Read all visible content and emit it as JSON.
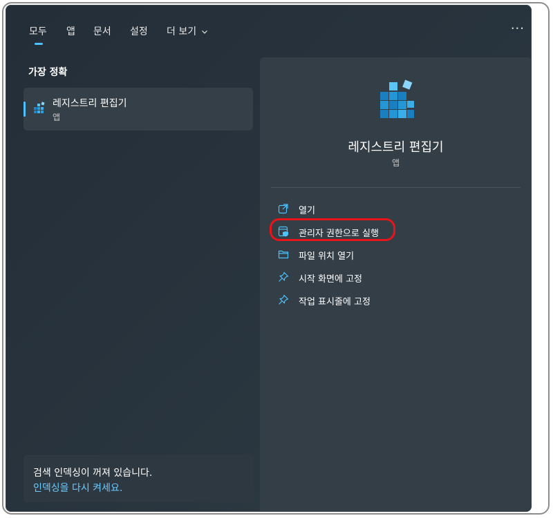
{
  "tabs": [
    {
      "label": "모두",
      "active": true
    },
    {
      "label": "앱",
      "active": false
    },
    {
      "label": "문서",
      "active": false
    },
    {
      "label": "설정",
      "active": false
    },
    {
      "label": "더 보기",
      "active": false
    }
  ],
  "more_options_icon": "ellipsis-icon",
  "left": {
    "section_title": "가장 정확",
    "best_match": {
      "name": "레지스트리 편집기",
      "type": "앱",
      "icon": "registry-editor-icon"
    },
    "index_notice": {
      "message": "검색 인덱싱이 꺼져 있습니다.",
      "link": "인덱싱을 다시 켜세요."
    }
  },
  "detail": {
    "app_name": "레지스트리 편집기",
    "app_type": "앱",
    "actions": [
      {
        "label": "열기",
        "icon": "open-external-icon"
      },
      {
        "label": "관리자 권한으로 실행",
        "icon": "shield-admin-icon",
        "highlighted": true
      },
      {
        "label": "파일 위치 열기",
        "icon": "folder-icon"
      },
      {
        "label": "시작 화면에 고정",
        "icon": "pin-icon"
      },
      {
        "label": "작업 표시줄에 고정",
        "icon": "pin-icon"
      }
    ]
  },
  "colors": {
    "accent": "#4cc2ff",
    "highlight": "#e8141a",
    "link": "#6ccbff"
  }
}
